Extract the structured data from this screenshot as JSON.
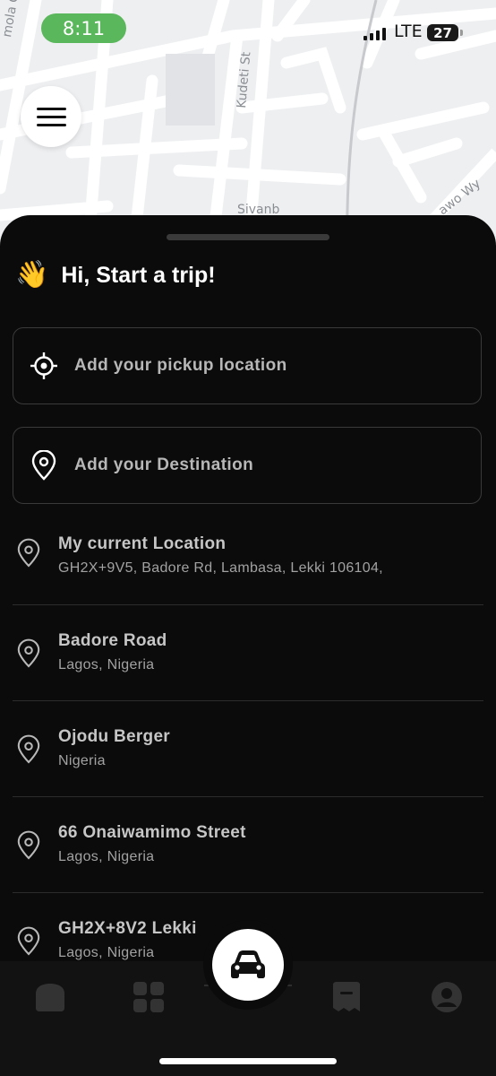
{
  "status_bar": {
    "time": "8:11",
    "network": "LTE",
    "battery": "27"
  },
  "map": {
    "streets": [
      "Kudeti St",
      "Sivanb",
      "awo Wy",
      "mola C"
    ]
  },
  "greeting": {
    "emoji": "👋",
    "text": "Hi, Start a trip!"
  },
  "pickup": {
    "placeholder": "Add your pickup location",
    "icon": "crosshair-icon"
  },
  "destination": {
    "placeholder": "Add your Destination",
    "icon": "location-pin-icon"
  },
  "recent_places": [
    {
      "title": "My current Location",
      "subtitle": "GH2X+9V5, Badore Rd, Lambasa, Lekki 106104,"
    },
    {
      "title": "Badore Road",
      "subtitle": "Lagos, Nigeria"
    },
    {
      "title": "Ojodu Berger",
      "subtitle": "Nigeria"
    },
    {
      "title": "66 Onaiwamimo Street",
      "subtitle": "Lagos, Nigeria"
    },
    {
      "title": "GH2X+8V2 Lekki",
      "subtitle": "Lagos, Nigeria"
    }
  ],
  "tabs": [
    "home-icon",
    "grid-icon",
    "car-icon",
    "receipt-icon",
    "profile-icon"
  ],
  "colors": {
    "accent_green": "#5bb75b",
    "sheet_bg": "#0b0b0b",
    "map_bg": "#eeeff1"
  }
}
